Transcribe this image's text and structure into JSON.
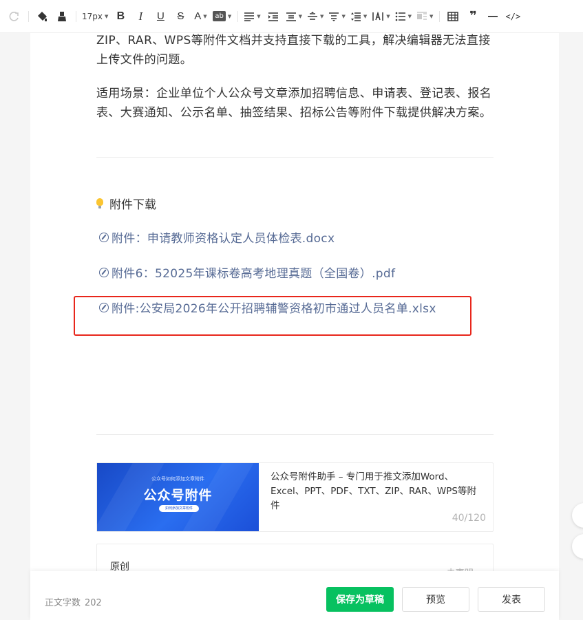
{
  "toolbar": {
    "font_size": "17px",
    "bold": "B",
    "italic": "I",
    "underline": "U",
    "strike": "S",
    "font_color": "A",
    "highlight": "ab",
    "quote": "❞",
    "code": "</>"
  },
  "article": {
    "para1": "ZIP、RAR、WPS等附件文档并支持直接下载的工具，解决编辑器无法直接上传文件的问题。",
    "para2": "适用场景：企业单位个人公众号文章添加招聘信息、申请表、登记表、报名表、大赛通知、公示名单、抽签结果、招标公告等附件下载提供解决方案。",
    "heading": "附件下载",
    "attachments": [
      "附件：申请教师资格认定人员体检表.docx",
      "附件6：52025年课标卷高考地理真题（全国卷）.pdf",
      "附件:公安局2026年公开招聘辅警资格初市通过人员名单.xlsx"
    ]
  },
  "cover_card": {
    "cover_small": "公众号如何添加文章附件",
    "cover_big": "公众号附件",
    "cover_pill": "如何添加文章附件",
    "description": "公众号附件助手 – 专门用于推文添加Word、Excel、PPT、PDF、TXT、ZIP、RAR、WPS等附件",
    "count": "40/120"
  },
  "original": {
    "title": "原创",
    "status": "未声明 ›"
  },
  "footer": {
    "word_count_label": "正文字数",
    "word_count": "202",
    "save_draft": "保存为草稿",
    "preview": "预览",
    "publish": "发表"
  },
  "colors": {
    "accent": "#07c160",
    "link": "#576b95",
    "highlight_box": "#e8261b"
  }
}
